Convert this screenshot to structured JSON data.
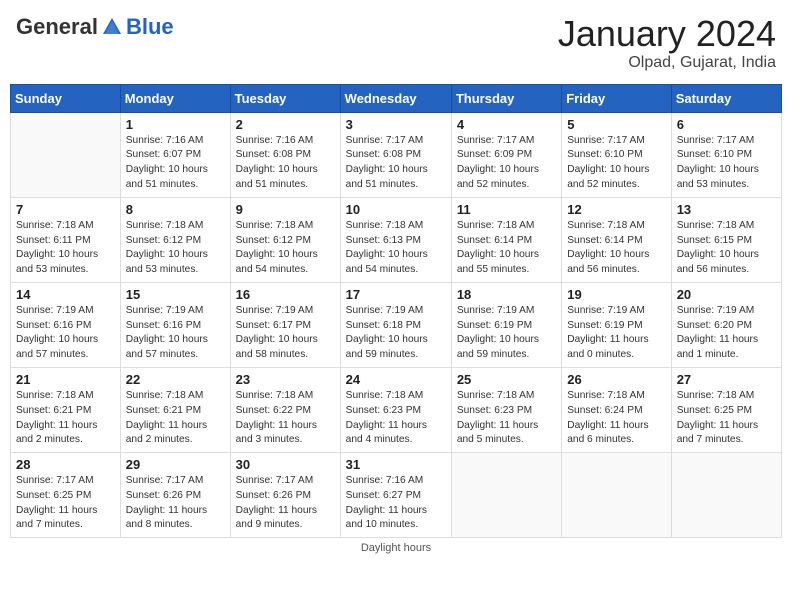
{
  "header": {
    "logo_general": "General",
    "logo_blue": "Blue",
    "month_title": "January 2024",
    "location": "Olpad, Gujarat, India"
  },
  "days_of_week": [
    "Sunday",
    "Monday",
    "Tuesday",
    "Wednesday",
    "Thursday",
    "Friday",
    "Saturday"
  ],
  "weeks": [
    [
      {
        "day": "",
        "info": ""
      },
      {
        "day": "1",
        "info": "Sunrise: 7:16 AM\nSunset: 6:07 PM\nDaylight: 10 hours\nand 51 minutes."
      },
      {
        "day": "2",
        "info": "Sunrise: 7:16 AM\nSunset: 6:08 PM\nDaylight: 10 hours\nand 51 minutes."
      },
      {
        "day": "3",
        "info": "Sunrise: 7:17 AM\nSunset: 6:08 PM\nDaylight: 10 hours\nand 51 minutes."
      },
      {
        "day": "4",
        "info": "Sunrise: 7:17 AM\nSunset: 6:09 PM\nDaylight: 10 hours\nand 52 minutes."
      },
      {
        "day": "5",
        "info": "Sunrise: 7:17 AM\nSunset: 6:10 PM\nDaylight: 10 hours\nand 52 minutes."
      },
      {
        "day": "6",
        "info": "Sunrise: 7:17 AM\nSunset: 6:10 PM\nDaylight: 10 hours\nand 53 minutes."
      }
    ],
    [
      {
        "day": "7",
        "info": "Sunrise: 7:18 AM\nSunset: 6:11 PM\nDaylight: 10 hours\nand 53 minutes."
      },
      {
        "day": "8",
        "info": "Sunrise: 7:18 AM\nSunset: 6:12 PM\nDaylight: 10 hours\nand 53 minutes."
      },
      {
        "day": "9",
        "info": "Sunrise: 7:18 AM\nSunset: 6:12 PM\nDaylight: 10 hours\nand 54 minutes."
      },
      {
        "day": "10",
        "info": "Sunrise: 7:18 AM\nSunset: 6:13 PM\nDaylight: 10 hours\nand 54 minutes."
      },
      {
        "day": "11",
        "info": "Sunrise: 7:18 AM\nSunset: 6:14 PM\nDaylight: 10 hours\nand 55 minutes."
      },
      {
        "day": "12",
        "info": "Sunrise: 7:18 AM\nSunset: 6:14 PM\nDaylight: 10 hours\nand 56 minutes."
      },
      {
        "day": "13",
        "info": "Sunrise: 7:18 AM\nSunset: 6:15 PM\nDaylight: 10 hours\nand 56 minutes."
      }
    ],
    [
      {
        "day": "14",
        "info": "Sunrise: 7:19 AM\nSunset: 6:16 PM\nDaylight: 10 hours\nand 57 minutes."
      },
      {
        "day": "15",
        "info": "Sunrise: 7:19 AM\nSunset: 6:16 PM\nDaylight: 10 hours\nand 57 minutes."
      },
      {
        "day": "16",
        "info": "Sunrise: 7:19 AM\nSunset: 6:17 PM\nDaylight: 10 hours\nand 58 minutes."
      },
      {
        "day": "17",
        "info": "Sunrise: 7:19 AM\nSunset: 6:18 PM\nDaylight: 10 hours\nand 59 minutes."
      },
      {
        "day": "18",
        "info": "Sunrise: 7:19 AM\nSunset: 6:19 PM\nDaylight: 10 hours\nand 59 minutes."
      },
      {
        "day": "19",
        "info": "Sunrise: 7:19 AM\nSunset: 6:19 PM\nDaylight: 11 hours\nand 0 minutes."
      },
      {
        "day": "20",
        "info": "Sunrise: 7:19 AM\nSunset: 6:20 PM\nDaylight: 11 hours\nand 1 minute."
      }
    ],
    [
      {
        "day": "21",
        "info": "Sunrise: 7:18 AM\nSunset: 6:21 PM\nDaylight: 11 hours\nand 2 minutes."
      },
      {
        "day": "22",
        "info": "Sunrise: 7:18 AM\nSunset: 6:21 PM\nDaylight: 11 hours\nand 2 minutes."
      },
      {
        "day": "23",
        "info": "Sunrise: 7:18 AM\nSunset: 6:22 PM\nDaylight: 11 hours\nand 3 minutes."
      },
      {
        "day": "24",
        "info": "Sunrise: 7:18 AM\nSunset: 6:23 PM\nDaylight: 11 hours\nand 4 minutes."
      },
      {
        "day": "25",
        "info": "Sunrise: 7:18 AM\nSunset: 6:23 PM\nDaylight: 11 hours\nand 5 minutes."
      },
      {
        "day": "26",
        "info": "Sunrise: 7:18 AM\nSunset: 6:24 PM\nDaylight: 11 hours\nand 6 minutes."
      },
      {
        "day": "27",
        "info": "Sunrise: 7:18 AM\nSunset: 6:25 PM\nDaylight: 11 hours\nand 7 minutes."
      }
    ],
    [
      {
        "day": "28",
        "info": "Sunrise: 7:17 AM\nSunset: 6:25 PM\nDaylight: 11 hours\nand 7 minutes."
      },
      {
        "day": "29",
        "info": "Sunrise: 7:17 AM\nSunset: 6:26 PM\nDaylight: 11 hours\nand 8 minutes."
      },
      {
        "day": "30",
        "info": "Sunrise: 7:17 AM\nSunset: 6:26 PM\nDaylight: 11 hours\nand 9 minutes."
      },
      {
        "day": "31",
        "info": "Sunrise: 7:16 AM\nSunset: 6:27 PM\nDaylight: 11 hours\nand 10 minutes."
      },
      {
        "day": "",
        "info": ""
      },
      {
        "day": "",
        "info": ""
      },
      {
        "day": "",
        "info": ""
      }
    ]
  ],
  "footer": {
    "text": "Daylight hours",
    "link": "https://www.generalblue.com"
  }
}
